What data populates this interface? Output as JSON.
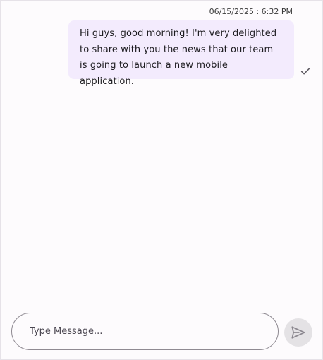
{
  "message": {
    "timestamp": "06/15/2025 : 6:32 PM",
    "text": "Hi guys, good morning! I'm very delighted to share with you the news that our team is going to launch a new mobile application.",
    "status_icon": "check-icon"
  },
  "composer": {
    "placeholder": "Type Message...",
    "value": "",
    "send_icon": "send-icon"
  },
  "colors": {
    "bubble_background": "#f3ebfd",
    "send_button_background": "#e4e2e5",
    "icon_color": "#5f5b63"
  }
}
